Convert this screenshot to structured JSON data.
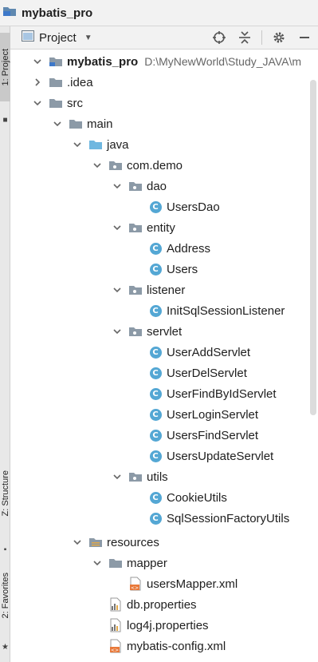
{
  "breadcrumb": {
    "title": "mybatis_pro"
  },
  "header": {
    "view_label": "Project"
  },
  "stripe": {
    "project_tab": "1: Project",
    "structure_tab": "Z: Structure",
    "favorites_tab": "2: Favorites"
  },
  "tree": {
    "root": {
      "label": "mybatis_pro",
      "path": "D:\\MyNewWorld\\Study_JAVA\\m"
    },
    "idea": "idea",
    "src": "src",
    "main": "main",
    "java": "java",
    "com_demo": "com.demo",
    "dao": "dao",
    "users_dao": "UsersDao",
    "entity": "entity",
    "address": "Address",
    "users": "Users",
    "listener": "listener",
    "init_listener": "InitSqlSessionListener",
    "servlet": "servlet",
    "servlets": [
      "UserAddServlet",
      "UserDelServlet",
      "UserFindByIdServlet",
      "UserLoginServlet",
      "UsersFindServlet",
      "UsersUpdateServlet"
    ],
    "utils": "utils",
    "cookie_utils": "CookieUtils",
    "sql_factory_utils": "SqlSessionFactoryUtils",
    "resources": "resources",
    "mapper": "mapper",
    "users_mapper": "usersMapper.xml",
    "db_props": "db.properties",
    "log4j_props": "log4j.properties",
    "mybatis_config": "mybatis-config.xml"
  },
  "colors": {
    "folder": "#8c9aa7",
    "source_folder": "#6fb7e0",
    "class_icon": "#54a7d4",
    "xml_icon": "#e8793a"
  }
}
